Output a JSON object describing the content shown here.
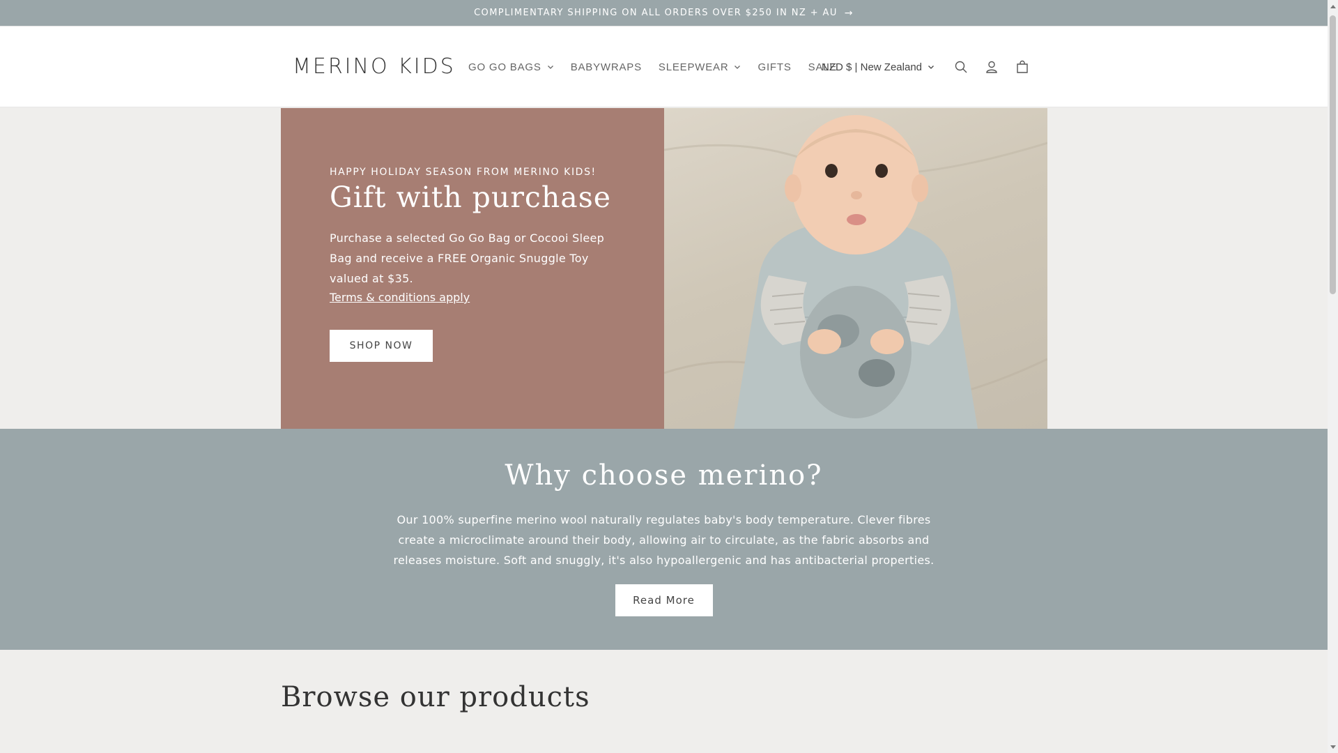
{
  "announcement": {
    "text": "COMPLIMENTARY SHIPPING ON ALL ORDERS OVER $250 IN NZ + AU",
    "arrow": "→"
  },
  "header": {
    "logo": "MERINO KIDS",
    "nav": [
      {
        "label": "GO GO BAGS",
        "dropdown": true
      },
      {
        "label": "BABYWRAPS",
        "dropdown": false
      },
      {
        "label": "SLEEPWEAR",
        "dropdown": true
      },
      {
        "label": "GIFTS",
        "dropdown": false
      },
      {
        "label": "SALE",
        "dropdown": false
      }
    ],
    "currency": "NZD $ | New Zealand",
    "icons": [
      "search-icon",
      "account-icon",
      "cart-icon"
    ]
  },
  "hero": {
    "kicker": "HAPPY HOLIDAY SEASON FROM MERINO KIDS!",
    "title": "Gift with purchase",
    "description": "Purchase a selected Go Go Bag or Cocooi Sleep Bag and receive a FREE Organic Snuggle Toy valued at $35.",
    "link": "Terms & conditions apply",
    "button": "SHOP NOW"
  },
  "why": {
    "title": "Why choose merino?",
    "body": "Our 100% superfine merino wool naturally regulates baby's body temperature. Clever fibres create a microclimate around their body, allowing air to circulate, as the fabric absorbs and releases moisture. Soft and snuggly, it's also hypoallergenic and has antibacterial properties.",
    "button": "Read More"
  },
  "browse": {
    "title": "Browse our products"
  },
  "colors": {
    "hero_panel": "#a77e73",
    "band": "#9aa6a9",
    "background": "#efeeec"
  }
}
